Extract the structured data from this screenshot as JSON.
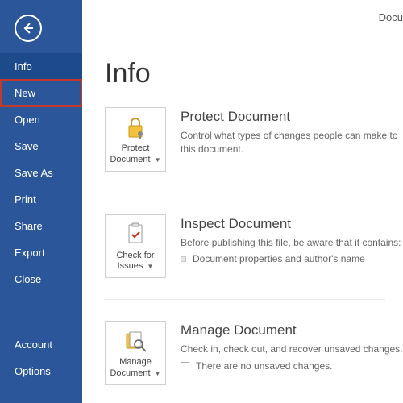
{
  "titlebar": {
    "doc_fragment": "Docu"
  },
  "sidebar": {
    "items": [
      {
        "label": "Info",
        "active": true
      },
      {
        "label": "New",
        "highlight": true
      },
      {
        "label": "Open"
      },
      {
        "label": "Save"
      },
      {
        "label": "Save As"
      },
      {
        "label": "Print"
      },
      {
        "label": "Share"
      },
      {
        "label": "Export"
      },
      {
        "label": "Close"
      }
    ],
    "footer": [
      {
        "label": "Account"
      },
      {
        "label": "Options"
      }
    ]
  },
  "main": {
    "title": "Info",
    "sections": [
      {
        "tile": {
          "label": "Protect Document",
          "icon": "lock-icon"
        },
        "heading": "Protect Document",
        "text": "Control what types of changes people can make to this document."
      },
      {
        "tile": {
          "label": "Check for Issues",
          "icon": "inspect-icon"
        },
        "heading": "Inspect Document",
        "text": "Before publishing this file, be aware that it contains:",
        "bullets": [
          {
            "kind": "sq",
            "text": "Document properties and author's name"
          }
        ]
      },
      {
        "tile": {
          "label": "Manage Document",
          "icon": "manage-icon"
        },
        "heading": "Manage Document",
        "text": "Check in, check out, and recover unsaved changes.",
        "bullets": [
          {
            "kind": "doc",
            "text": "There are no unsaved changes."
          }
        ]
      }
    ]
  }
}
